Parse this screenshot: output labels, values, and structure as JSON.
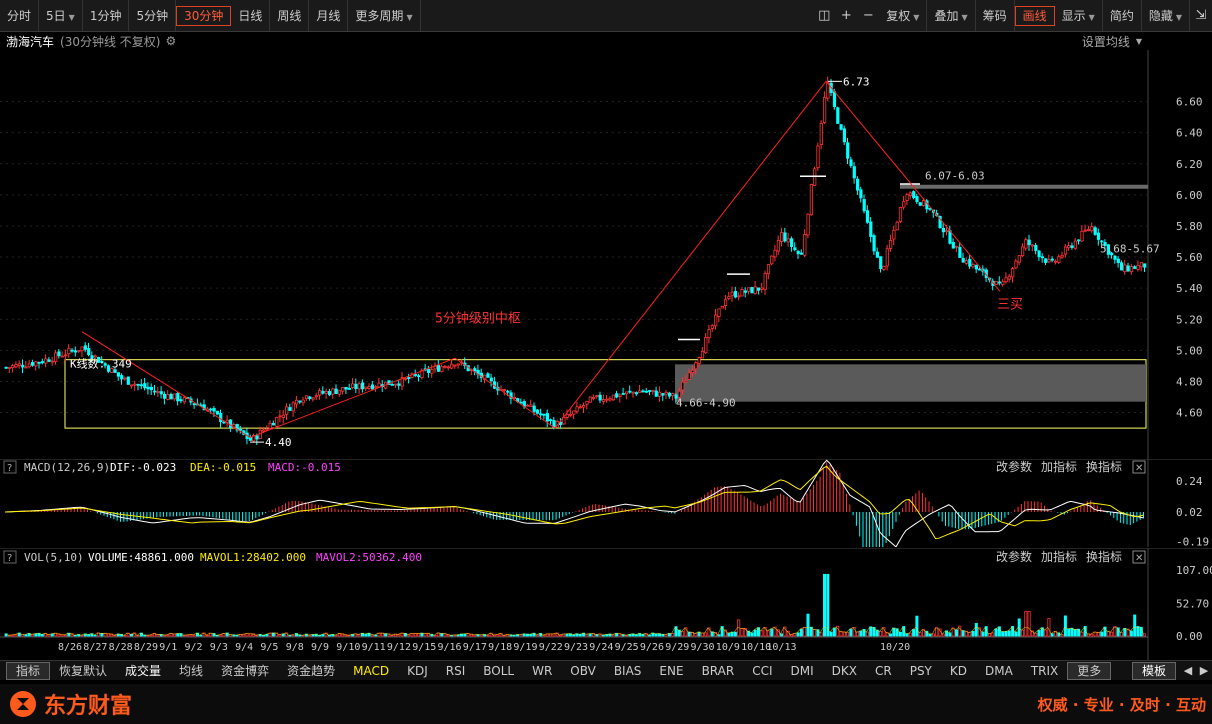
{
  "toolbar": {
    "periods": [
      {
        "label": "分时",
        "caret": false,
        "active": false
      },
      {
        "label": "5日",
        "caret": true,
        "active": false
      },
      {
        "label": "1分钟",
        "caret": false,
        "active": false
      },
      {
        "label": "5分钟",
        "caret": false,
        "active": false
      },
      {
        "label": "30分钟",
        "caret": false,
        "active": true
      },
      {
        "label": "日线",
        "caret": false,
        "active": false
      },
      {
        "label": "周线",
        "caret": false,
        "active": false
      },
      {
        "label": "月线",
        "caret": false,
        "active": false
      },
      {
        "label": "更多周期",
        "caret": true,
        "active": false
      }
    ],
    "right_buttons": [
      {
        "label": "复权",
        "caret": true,
        "active": false
      },
      {
        "label": "叠加",
        "caret": true,
        "active": false
      },
      {
        "label": "筹码",
        "caret": false,
        "active": false
      },
      {
        "label": "画线",
        "caret": false,
        "active": true
      },
      {
        "label": "显示",
        "caret": true,
        "active": false
      },
      {
        "label": "简约",
        "caret": false,
        "active": false
      },
      {
        "label": "隐藏",
        "caret": true,
        "active": false
      }
    ]
  },
  "header": {
    "stock_name": "渤海汽车",
    "chart_desc": "(30分钟线 不复权)",
    "ma_settings": "设置均线",
    "colors": {
      "name": "#ffffff",
      "desc": "#999999"
    }
  },
  "main_chart": {
    "y_ticks": [
      "6.60",
      "6.40",
      "6.20",
      "6.00",
      "5.80",
      "5.60",
      "5.40",
      "5.20",
      "5.00",
      "4.80",
      "4.60"
    ],
    "x_ticks": [
      "8/26",
      "8/27",
      "8/28",
      "8/29",
      "9/1",
      "9/2",
      "9/3",
      "9/4",
      "9/5",
      "9/8",
      "9/9",
      "9/10",
      "9/11",
      "9/12",
      "9/15",
      "9/16",
      "9/17",
      "9/18",
      "9/19",
      "9/22",
      "9/23",
      "9/24",
      "9/25",
      "9/26",
      "9/29",
      "9/30",
      "10/9",
      "10/10",
      "10/13",
      "10/20"
    ],
    "annotations": {
      "kline_count": "K线数: 349",
      "pivot_label": "5分钟级别中枢",
      "third_buy": "三买",
      "high": "6.73",
      "low": "4.40",
      "range_upper": "6.07-6.03",
      "range_right": "5.68-5.67",
      "range_lower": "4.66-4.90"
    },
    "colors": {
      "up": "#ff3333",
      "down": "#00ffff",
      "line": "#ff2020",
      "box": "#ffff66"
    }
  },
  "macd_panel": {
    "name": "MACD(12,26,9)",
    "dif": "DIF:-0.023",
    "dea": "DEA:-0.015",
    "macd": "MACD:-0.015",
    "y_ticks": [
      "0.24",
      "0.02",
      "-0.19"
    ],
    "actions": [
      "改参数",
      "加指标",
      "换指标"
    ]
  },
  "vol_panel": {
    "name": "VOL(5,10)",
    "volume": "VOLUME:48861.000",
    "mavol1": "MAVOL1:28402.000",
    "mavol2": "MAVOL2:50362.400",
    "y_ticks": [
      "107.00",
      "52.70",
      "0.00"
    ],
    "actions": [
      "改参数",
      "加指标",
      "换指标"
    ]
  },
  "subbar": {
    "tabs": [
      {
        "label": "指标",
        "style": "boxed"
      },
      {
        "label": "恢复默认",
        "style": ""
      },
      {
        "label": "成交量",
        "style": "white"
      },
      {
        "label": "均线",
        "style": ""
      },
      {
        "label": "资金博弈",
        "style": ""
      },
      {
        "label": "资金趋势",
        "style": ""
      },
      {
        "label": "MACD",
        "style": "hl"
      },
      {
        "label": "KDJ",
        "style": ""
      },
      {
        "label": "RSI",
        "style": ""
      },
      {
        "label": "BOLL",
        "style": ""
      },
      {
        "label": "WR",
        "style": ""
      },
      {
        "label": "OBV",
        "style": ""
      },
      {
        "label": "BIAS",
        "style": ""
      },
      {
        "label": "ENE",
        "style": ""
      },
      {
        "label": "BRAR",
        "style": ""
      },
      {
        "label": "CCI",
        "style": ""
      },
      {
        "label": "DMI",
        "style": ""
      },
      {
        "label": "DKX",
        "style": ""
      },
      {
        "label": "CR",
        "style": ""
      },
      {
        "label": "PSY",
        "style": ""
      },
      {
        "label": "KD",
        "style": ""
      },
      {
        "label": "DMA",
        "style": ""
      },
      {
        "label": "TRIX",
        "style": ""
      },
      {
        "label": "更多",
        "style": "boxed"
      }
    ],
    "template_label": "模板"
  },
  "footer": {
    "brand": "东方财富",
    "slogan": "权威 · 专业 · 及时 · 互动",
    "colors": {
      "accent": "#ff5a1e"
    }
  }
}
